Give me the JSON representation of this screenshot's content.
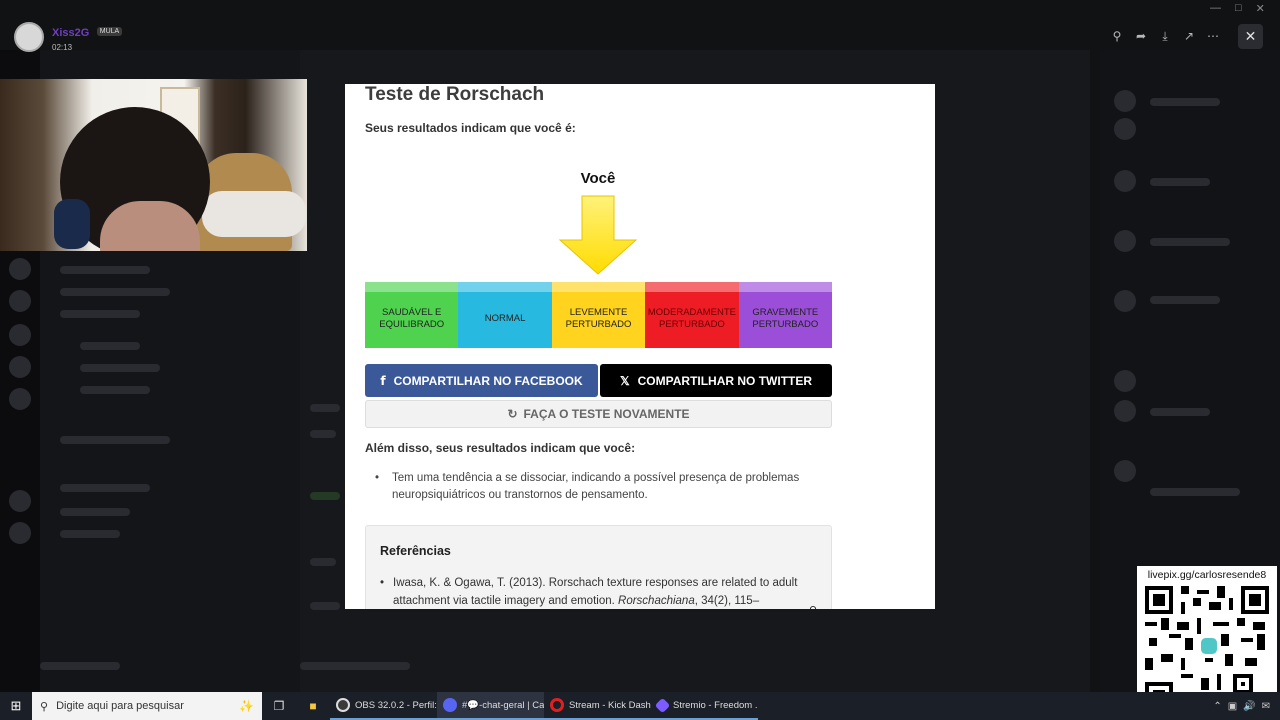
{
  "viewer": {
    "username": "Xiss2G",
    "badge": "MULA",
    "time": "02:13"
  },
  "modal": {
    "title": "Teste de Rorschach",
    "subtitle": "Seus resultados indicam que você é:",
    "marker_label": "Você",
    "scale": [
      "SAUDÁVEL E EQUILIBRADO",
      "NORMAL",
      "LEVEMENTE PERTURBADO",
      "MODERADAMENTE PERTURBADO",
      "GRAVEMENTE PERTURBADO"
    ],
    "scale_colors": [
      "#4fd34f",
      "#27b9e0",
      "#ffd31e",
      "#ee1c24",
      "#9b4fd9"
    ],
    "facebook_label": "COMPARTILHAR NO FACEBOOK",
    "twitter_label": "COMPARTILHAR NO TWITTER",
    "retry_label": "FAÇA O TESTE NOVAMENTE",
    "also_heading": "Além disso, seus resultados indicam que você:",
    "findings": [
      "Tem uma tendência a se dissociar, indicando a possível presença de problemas neuropsiquiátricos ou transtornos de pensamento."
    ],
    "references_title": "Referências",
    "reference_text": "Iwasa, K. & Ogawa, T. (2013). Rorschach texture responses are related to adult attachment via tactile imagery and emotion.",
    "reference_journal": "Rorschachiana",
    "reference_tail": ", 34(2), 115–"
  },
  "qr": {
    "url": "livepix.gg/carlosresende8"
  },
  "taskbar": {
    "search_placeholder": "Digite aqui para pesquisar",
    "apps": [
      {
        "label": "OBS 32.0.2 - Perfil: ...",
        "color": "#3a3a3a"
      },
      {
        "label": "#💬-chat-geral | Ca...",
        "color": "#5865f2"
      },
      {
        "label": "Stream - Kick Dash...",
        "color": "#e02020"
      },
      {
        "label": "Stremio - Freedom ...",
        "color": "#7b5cff"
      }
    ]
  },
  "icons": {
    "accent_username": "#6f3fbf"
  }
}
